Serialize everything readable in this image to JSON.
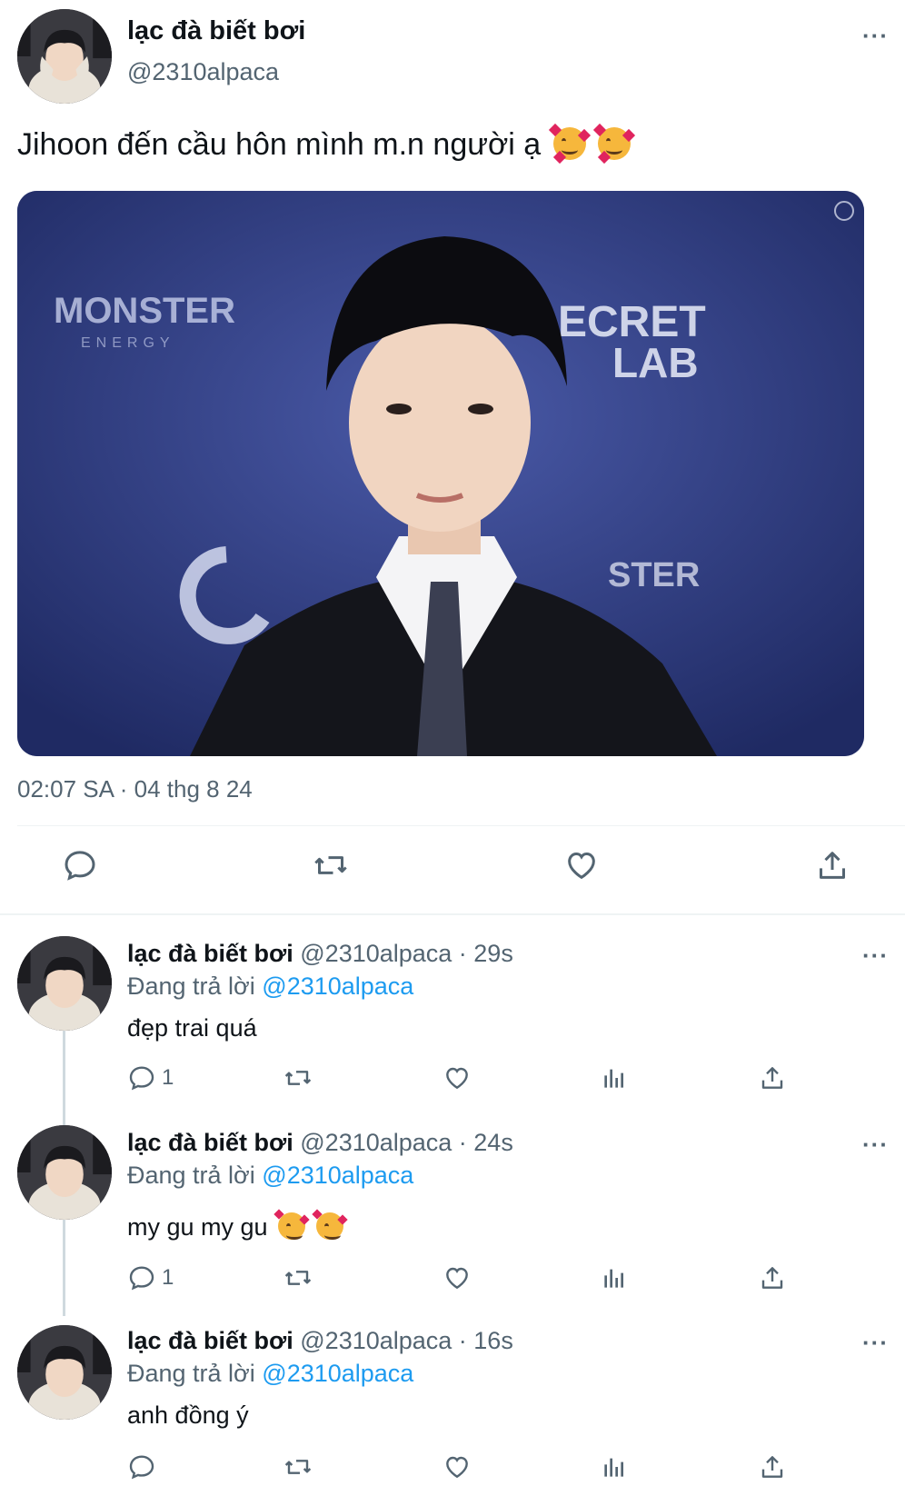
{
  "main_post": {
    "display_name": "lạc đà biết bơi",
    "handle": "@2310alpaca",
    "text": "Jihoon đến cầu hôn mình m.n người ạ",
    "timestamp": "02:07 SA · 04 thg 8 24",
    "more_icon": "···"
  },
  "photo": {
    "backdrop_text_left": "MONSTER",
    "backdrop_text_left_sub": "ENERGY",
    "backdrop_text_right_1": "ECRET",
    "backdrop_text_right_2": "LAB",
    "backdrop_text_bottom": "STER",
    "backdrop_color": "#2e3a78"
  },
  "replies": [
    {
      "display_name": "lạc đà biết bơi",
      "meta": "@2310alpaca · 29s",
      "replying_prefix": "Đang trả lời",
      "replying_to": "@2310alpaca",
      "text": "đẹp trai quá",
      "reply_count": "1"
    },
    {
      "display_name": "lạc đà biết bơi",
      "meta": "@2310alpaca · 24s",
      "replying_prefix": "Đang trả lời",
      "replying_to": "@2310alpaca",
      "text": "my gu my gu",
      "reply_count": "1"
    },
    {
      "display_name": "lạc đà biết bơi",
      "meta": "@2310alpaca · 16s",
      "replying_prefix": "Đang trả lời",
      "replying_to": "@2310alpaca",
      "text": "anh đồng ý",
      "reply_count": ""
    }
  ],
  "colors": {
    "link": "#1d9bf0",
    "secondary_text": "#536471",
    "primary_text": "#0f1419",
    "divider": "#eff3f4"
  }
}
